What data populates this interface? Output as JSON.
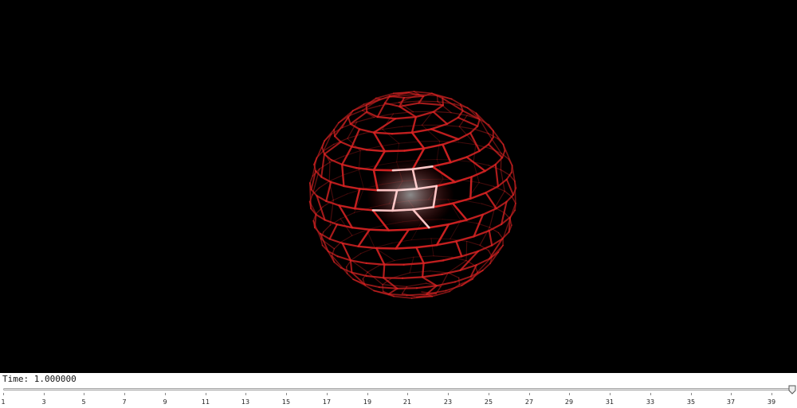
{
  "viewport": {
    "background": "#000000",
    "model_color": "#d42222",
    "highlight_color": "#ffd8d8",
    "model_kind": "sphere-lattice-model"
  },
  "time_panel": {
    "label": "Time: 1.000000",
    "slider_value": 39,
    "slider_min": 1,
    "slider_max": 39,
    "tick_labels": [
      "1",
      "3",
      "5",
      "7",
      "9",
      "11",
      "13",
      "15",
      "17",
      "19",
      "21",
      "23",
      "25",
      "27",
      "29",
      "31",
      "33",
      "35",
      "37",
      "39"
    ]
  }
}
